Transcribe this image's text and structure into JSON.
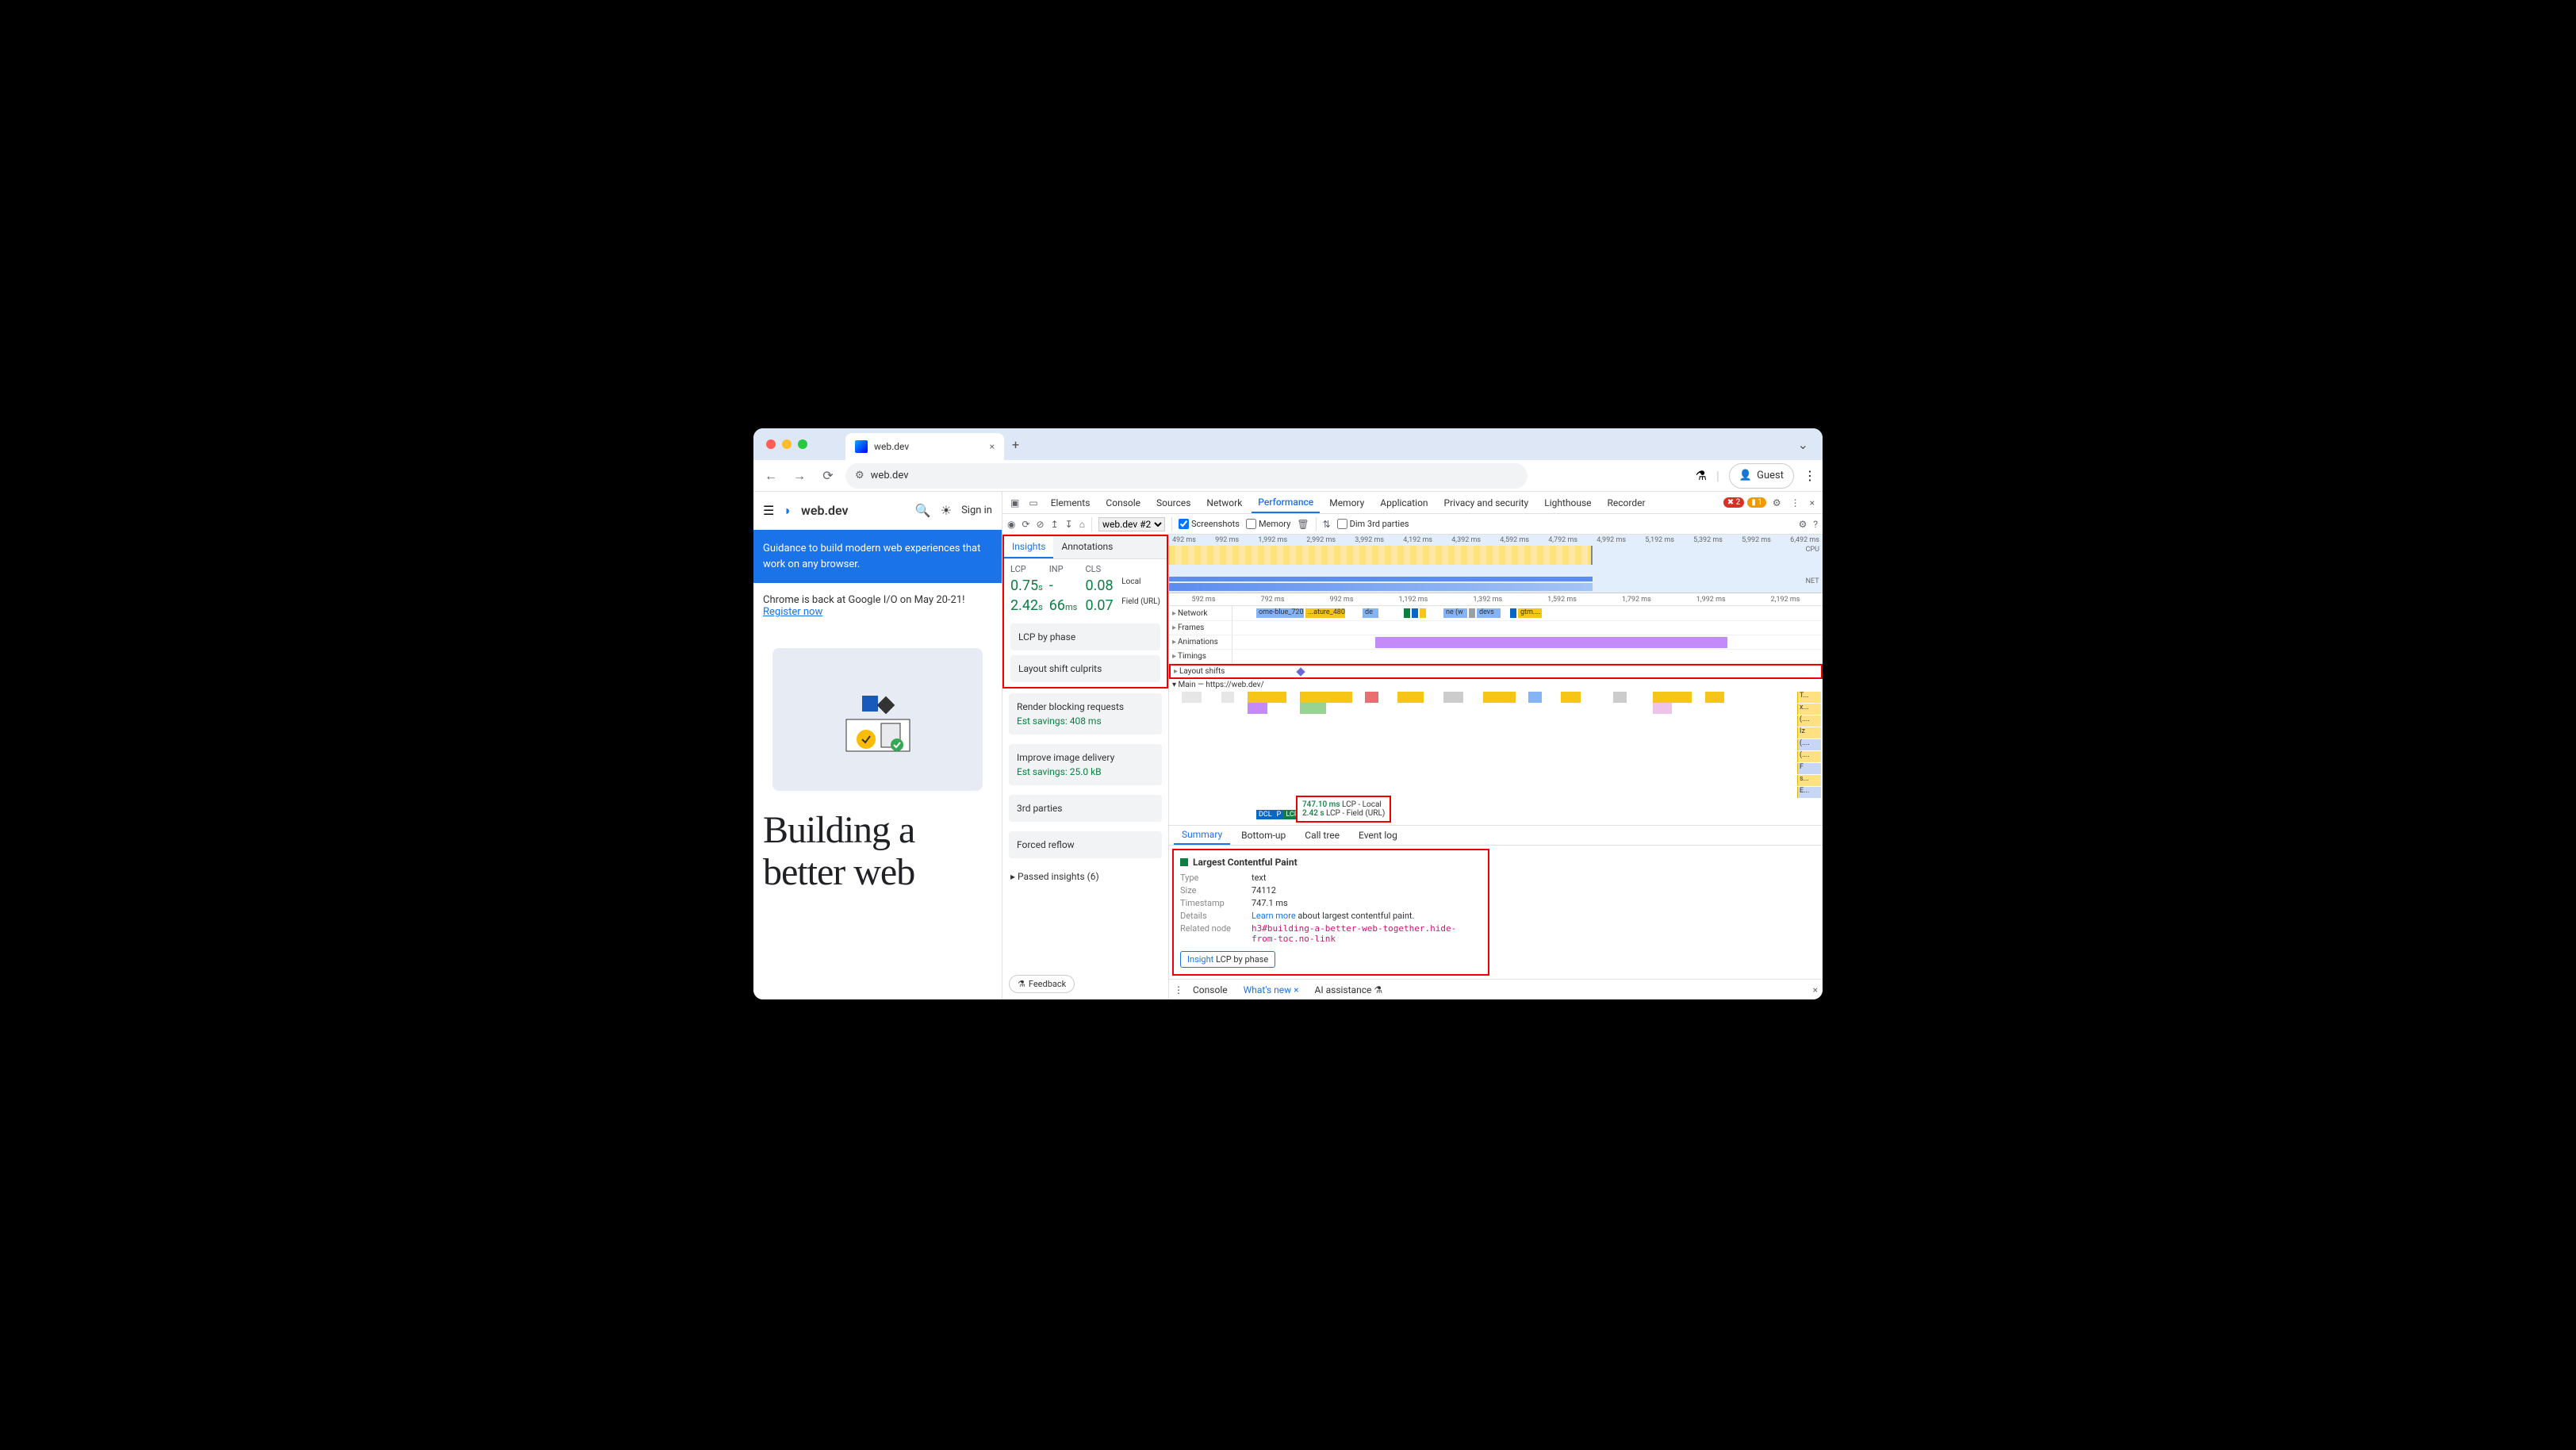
{
  "browser": {
    "tab_title": "web.dev",
    "url": "web.dev",
    "guest_label": "Guest"
  },
  "page": {
    "logo": "web.dev",
    "signin": "Sign in",
    "banner": "Guidance to build modern web experiences that work on any browser.",
    "io_text": "Chrome is back at Google I/O on May 20-21!",
    "io_register": "Register now",
    "hero": "Building a better web"
  },
  "devtools": {
    "tabs": [
      "Elements",
      "Console",
      "Sources",
      "Network",
      "Performance",
      "Memory",
      "Application",
      "Privacy and security",
      "Lighthouse",
      "Recorder"
    ],
    "active_tab": "Performance",
    "errors": "2",
    "warnings": "1",
    "toolbar": {
      "recording_select": "web.dev #2",
      "screenshots": "Screenshots",
      "memory": "Memory",
      "dim3rd": "Dim 3rd parties"
    },
    "overview_ticks": [
      "492 ms",
      "992 ms",
      "1,992 ms",
      "2,992 ms",
      "3,992 ms",
      "4,192 ms",
      "4,392 ms",
      "4,592 ms",
      "4,792 ms",
      "4,992 ms",
      "5,192 ms",
      "5,392 ms",
      "5,992 ms",
      "6,492 ms"
    ],
    "overview_cpu": "CPU",
    "overview_net": "NET",
    "ruler_ticks": [
      "592 ms",
      "792 ms",
      "992 ms",
      "1,192 ms",
      "1,392 ms",
      "1,592 ms",
      "1,792 ms",
      "1,992 ms",
      "2,192 ms"
    ],
    "insights": {
      "tabs": [
        "Insights",
        "Annotations"
      ],
      "headers": {
        "lcp": "LCP",
        "inp": "INP",
        "cls": "CLS"
      },
      "row_labels": {
        "local": "Local",
        "field": "Field (URL)"
      },
      "local": {
        "lcp": "0.75",
        "lcp_unit": "s",
        "inp": "-",
        "cls": "0.08"
      },
      "field": {
        "lcp": "2.42",
        "lcp_unit": "s",
        "inp": "66",
        "inp_unit": "ms",
        "cls": "0.07"
      },
      "cards": {
        "lcp_phase": "LCP by phase",
        "layout_shift": "Layout shift culprits",
        "render_block": "Render blocking requests",
        "render_block_sav": "Est savings: 408 ms",
        "image_delivery": "Improve image delivery",
        "image_delivery_sav": "Est savings: 25.0 kB",
        "third": "3rd parties",
        "forced": "Forced reflow"
      },
      "passed": "Passed insights (6)",
      "feedback": "Feedback"
    },
    "tracks": {
      "network": "Network",
      "net_items": [
        "ome-blue_720.png",
        "...ature_480...",
        "de",
        "ne (w",
        "devs",
        "gtm...."
      ],
      "frames": "Frames",
      "animations": "Animations",
      "timings": "Timings",
      "layout_shifts": "Layout shifts",
      "main": "Main — https://web.dev/",
      "flame_stack": [
        "T...",
        "x...",
        "(....",
        "Iz",
        "(....",
        "(....",
        "F",
        "s...",
        "E..."
      ]
    },
    "lcp_marker": {
      "local_time": "747.10 ms",
      "local_label": "LCP - Local",
      "field_time": "2.42 s",
      "field_label": "LCP - Field (URL)",
      "dcl": "DCL",
      "p": "P",
      "lcp": "LCP"
    },
    "detail_tabs": [
      "Summary",
      "Bottom-up",
      "Call tree",
      "Event log"
    ],
    "summary": {
      "title": "Largest Contentful Paint",
      "type_k": "Type",
      "type_v": "text",
      "size_k": "Size",
      "size_v": "74112",
      "ts_k": "Timestamp",
      "ts_v": "747.1 ms",
      "details_k": "Details",
      "details_link": "Learn more",
      "details_rest": " about largest contentful paint.",
      "node_k": "Related node",
      "node_v": "h3#building-a-better-web-together.hide-from-toc.no-link",
      "insight_label": "Insight",
      "insight_val": "LCP by phase"
    },
    "drawer": {
      "items": [
        "Console",
        "What's new",
        "AI assistance"
      ],
      "active": "What's new"
    }
  }
}
